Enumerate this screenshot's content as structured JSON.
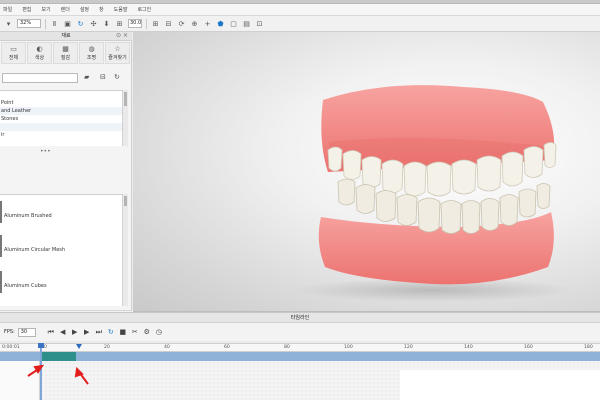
{
  "menubar": {
    "items": [
      "파일",
      "편집",
      "보기",
      "렌더",
      "설정",
      "창",
      "도움말",
      "로그인"
    ]
  },
  "toolbar": {
    "zoom_percent": "32%",
    "value_field": "30.0",
    "icons": [
      "folder-open-icon",
      "pause-icon",
      "refresh-icon",
      "move-icon",
      "download-icon",
      "grid-icon",
      "grid-icon",
      "measure-icon",
      "rotate-icon",
      "shield-icon",
      "cube-icon",
      "image-icon",
      "frame-icon"
    ]
  },
  "library": {
    "title": "재료",
    "categories": [
      {
        "label": "전체",
        "icon": "folder-icon"
      },
      {
        "label": "색상",
        "icon": "palette-icon"
      },
      {
        "label": "질감",
        "icon": "texture-icon"
      },
      {
        "label": "조명",
        "icon": "light-icon"
      },
      {
        "label": "즐겨찾기",
        "icon": "star-icon"
      }
    ],
    "tree_items": [
      "Points",
      "Point",
      "and Leather",
      "Stones",
      "",
      "ir"
    ],
    "materials": [
      {
        "name": "Aluminum Brushed"
      },
      {
        "name": "Aluminum Circular Mesh"
      },
      {
        "name": "Aluminum Cubes"
      }
    ]
  },
  "viewport": {
    "model": "teeth-model"
  },
  "timeline": {
    "title": "타임라인",
    "fps_label": "FPS:",
    "fps_value": "30",
    "time_label": "0:00:01",
    "ruler_ticks": [
      "0",
      "20",
      "40",
      "60",
      "80",
      "100",
      "120",
      "140",
      "160",
      "180"
    ],
    "range_start_frame": 0,
    "range_end_frame": 14
  },
  "colors": {
    "gum": "#f07f7f",
    "tooth": "#f4f1e8",
    "accent": "#1b78c8",
    "range": "#2f8f8a",
    "arrow": "#e11d1d"
  }
}
